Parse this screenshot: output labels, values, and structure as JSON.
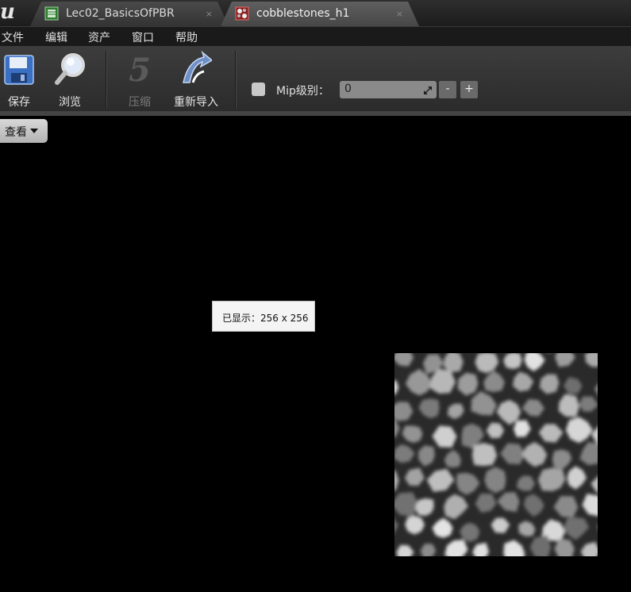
{
  "app": {
    "logo_glyph": "u"
  },
  "tabs": [
    {
      "label": "Lec02_BasicsOfPBR",
      "icon": "level-map-icon",
      "close": "×",
      "active": false
    },
    {
      "label": "cobblestones_h1",
      "icon": "texture-asset-icon",
      "close": "×",
      "active": true
    }
  ],
  "menu": [
    "文件",
    "编辑",
    "资产",
    "窗口",
    "帮助"
  ],
  "toolbar": {
    "save_label": "保存",
    "browse_label": "浏览",
    "compress_label": "压缩",
    "reimport_label": "重新导入",
    "mip_label": "Mip级别：",
    "mip_value": "0",
    "mip_enabled": false,
    "minus_label": "-",
    "plus_label": "+"
  },
  "viewport": {
    "view_menu_label": "查看",
    "info_text": "已显示：256 x 256"
  },
  "colors": {
    "background": "#000000",
    "toolbar": "#333333",
    "tooltip_bg": "#f4f4f4"
  }
}
